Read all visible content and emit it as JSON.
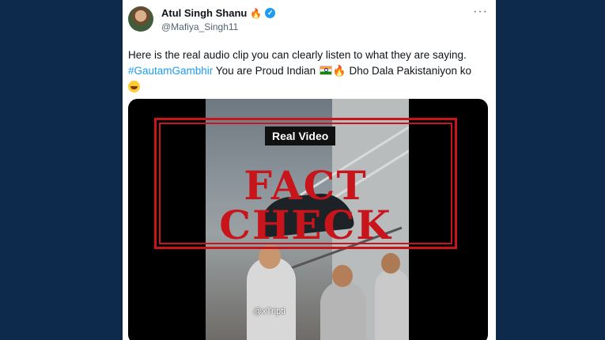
{
  "tweet": {
    "author": {
      "display_name": "Atul Singh Shanu",
      "name_emoji": "🔥",
      "handle": "@Mafiya_Singh11",
      "verified": true
    },
    "more_icon": "more-options-icon",
    "text": {
      "line1": "Here is the real audio clip you can clearly listen to what they are saying.",
      "hashtag": "#GautamGambhir",
      "rest": " You are Proud Indian ",
      "fire_emoji": "🔥",
      "tail": " Dho Dala Pakistaniyon ko"
    },
    "media": {
      "overlay_label": "Real Video",
      "stamp_text": "FACT CHECK",
      "watermark": "@xTripti"
    }
  },
  "colors": {
    "page_background": "#0d2a4d",
    "hashtag": "#1d9bf0",
    "verified_badge": "#1d9bf0",
    "stamp": "#c8141b"
  }
}
